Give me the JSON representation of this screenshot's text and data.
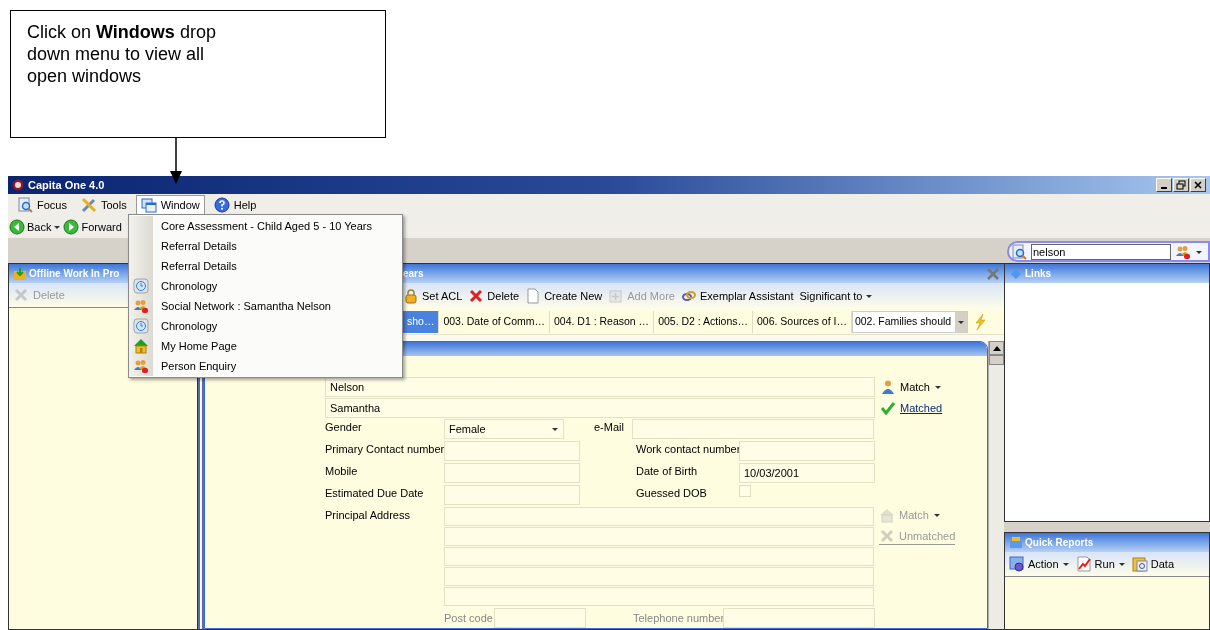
{
  "annotation": {
    "text": "Click on **Windows** drop down menu to view all open windows"
  },
  "window": {
    "title": "Capita One 4.0"
  },
  "menu_bar": [
    {
      "label": "Focus",
      "selected": false
    },
    {
      "label": "Tools",
      "selected": false
    },
    {
      "label": "Window",
      "selected": true
    },
    {
      "label": "Help",
      "selected": false
    }
  ],
  "window_menu": [
    {
      "label": "Core Assessment - Child Aged 5 - 10 Years"
    },
    {
      "label": "Referral Details"
    },
    {
      "label": "Referral Details"
    },
    {
      "label": "Chronology"
    },
    {
      "label": "Social Network : Samantha  Nelson"
    },
    {
      "label": "Chronology"
    },
    {
      "label": "My Home Page"
    },
    {
      "label": "Person Enquiry"
    }
  ],
  "nav": [
    {
      "label": "Back",
      "dropdown": true
    },
    {
      "label": "Forward",
      "dropdown": false
    }
  ],
  "search": {
    "value": "nelson"
  },
  "left_panel": {
    "title": "Offline Work In Pro",
    "toolbar": [
      {
        "label": "Delete",
        "disabled": true
      }
    ]
  },
  "center_panel": {
    "title": "ears",
    "toolbar": [
      {
        "label": "Set ACL",
        "disabled": false,
        "dropdown": false
      },
      {
        "label": "Delete",
        "disabled": false,
        "dropdown": false
      },
      {
        "label": "Create New",
        "disabled": false,
        "dropdown": false
      },
      {
        "label": "Add More",
        "disabled": true,
        "dropdown": false
      },
      {
        "label": "Exemplar Assistant",
        "disabled": false,
        "dropdown": false
      },
      {
        "label": "Significant to",
        "disabled": false,
        "dropdown": true
      }
    ],
    "tabs": [
      {
        "label": "sho…",
        "selected": true
      },
      {
        "label": "003. Date of Comm…",
        "selected": false
      },
      {
        "label": "004. D1 : Reason …",
        "selected": false
      },
      {
        "label": "005. D2 : Actions…",
        "selected": false
      },
      {
        "label": "006. Sources of I…",
        "selected": false
      }
    ],
    "tab_select": {
      "value": "002. Families should"
    },
    "form": {
      "name_lines": [
        "Nelson",
        "Samantha"
      ],
      "rows": [
        {
          "left": {
            "label": "Gender",
            "kind": "select",
            "value": "Female"
          },
          "right": {
            "label": "e-Mail",
            "kind": "wide"
          }
        },
        {
          "left": {
            "label": "Primary Contact number",
            "kind": "text"
          },
          "right": {
            "label": "Work contact number",
            "kind": "text"
          }
        },
        {
          "left": {
            "label": "Mobile",
            "kind": "text"
          },
          "right": {
            "label": "Date of Birth",
            "kind": "text",
            "value": "10/03/2001"
          }
        },
        {
          "left": {
            "label": "Estimated Due Date",
            "kind": "text"
          },
          "right": {
            "label": "Guessed DOB",
            "kind": "checkbox",
            "checked": false
          }
        }
      ],
      "address_label": "Principal Address",
      "postcode": {
        "label": "Post code",
        "disabled": true
      },
      "telephone": {
        "label": "Telephone number",
        "disabled": true
      },
      "person_match": {
        "label": "Match",
        "status": "Matched",
        "matched": true
      },
      "address_match": {
        "label": "Match",
        "status": "Unmatched",
        "matched": false
      }
    }
  },
  "links_panel": {
    "title": "Links"
  },
  "quick_reports": {
    "title": "Quick Reports",
    "toolbar": [
      {
        "label": "Action",
        "dropdown": true
      },
      {
        "label": "Run",
        "dropdown": true
      },
      {
        "label": "Data",
        "dropdown": false
      }
    ]
  }
}
